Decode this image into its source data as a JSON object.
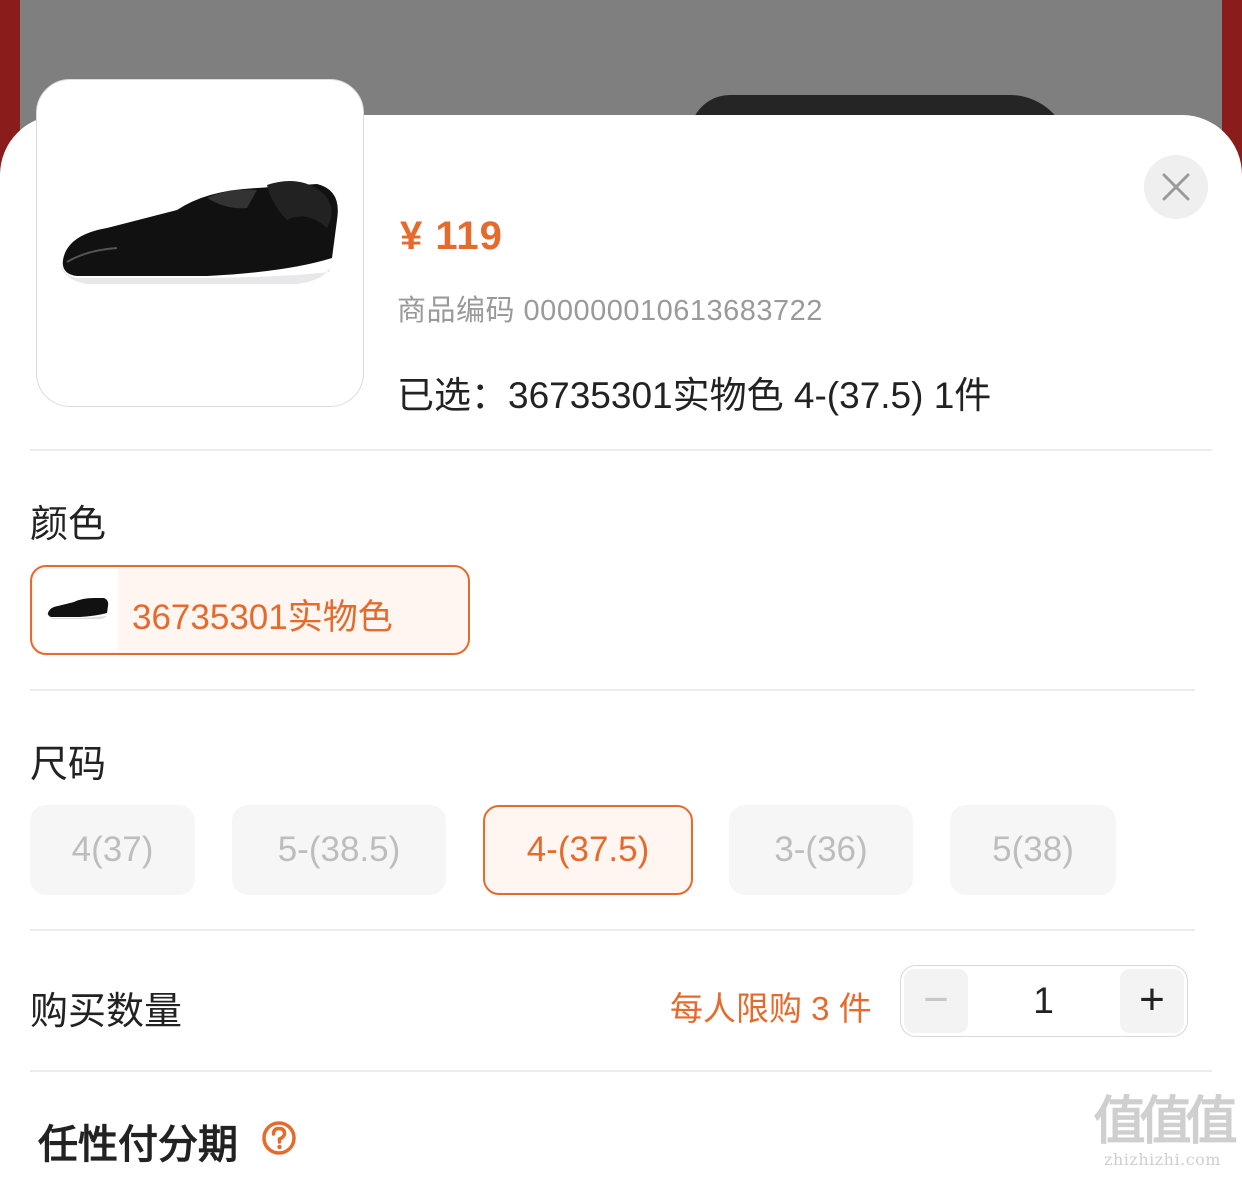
{
  "colors": {
    "accent": "#e66a2c",
    "muted": "#bdbdbd",
    "chip_bg": "#f6f6f6"
  },
  "product": {
    "price": "¥ 119",
    "sku_code": "商品编码 000000010613683722",
    "selected_summary": "已选：36735301实物色 4-(37.5)  1件",
    "image_alt": "black patent leather sneaker with bow"
  },
  "close_icon": "close-icon",
  "color_section": {
    "title": "颜色",
    "options": [
      {
        "label": "36735301实物色",
        "selected": true
      }
    ]
  },
  "size_section": {
    "title": "尺码",
    "options": [
      {
        "label": "4(37)",
        "selected": false
      },
      {
        "label": "5-(38.5)",
        "selected": false
      },
      {
        "label": "4-(37.5)",
        "selected": true
      },
      {
        "label": "3-(36)",
        "selected": false
      },
      {
        "label": "5(38)",
        "selected": false
      }
    ]
  },
  "quantity_section": {
    "title": "购买数量",
    "limit_text": "每人限购 3 件",
    "minus": "−",
    "plus": "+",
    "value": "1"
  },
  "installment": {
    "title": "任性付分期",
    "help_icon": "question-circle-icon"
  },
  "watermark": {
    "mark": "值值值",
    "site": "zhizhizhi.com"
  }
}
